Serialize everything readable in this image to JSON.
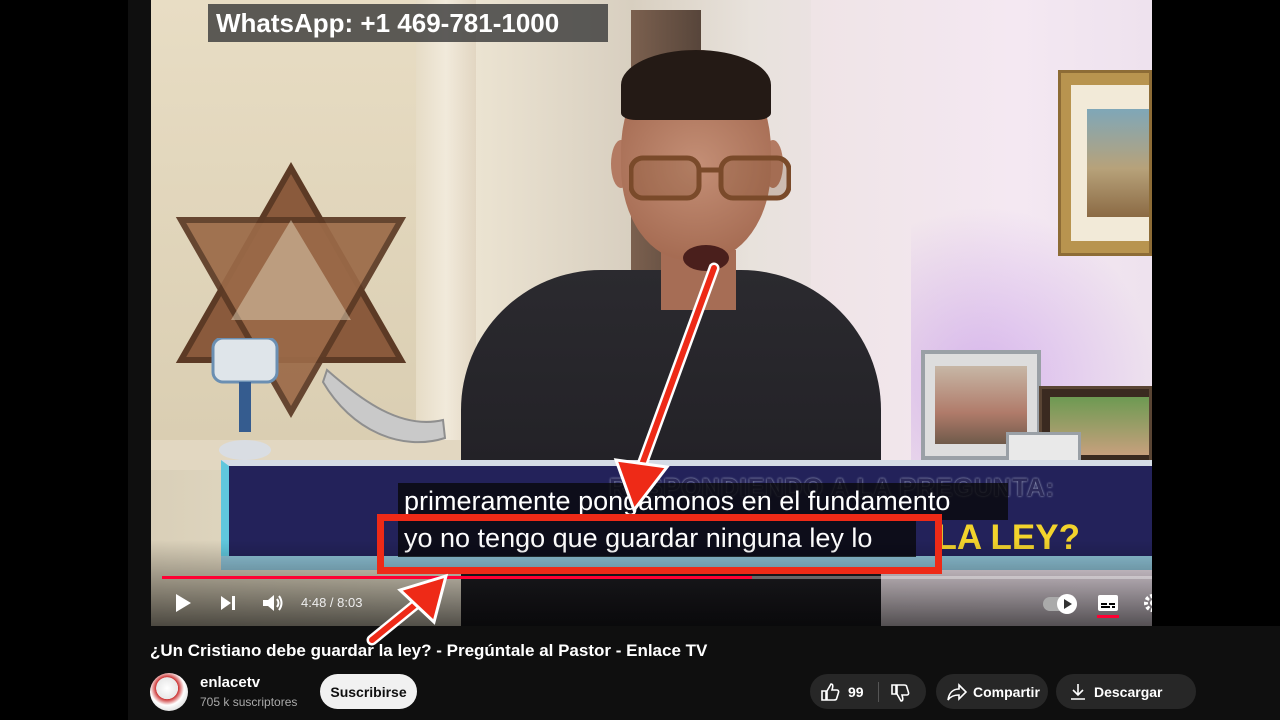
{
  "overlay": {
    "whatsapp": "WhatsApp: +1 469-781-1000",
    "banner_top": "RESPONDIENDO A LA PREGUNTA:",
    "banner_law": "LA LEY?"
  },
  "captions": [
    "primeramente pongámonos en el fundamento",
    "yo no tengo que guardar ninguna ley lo"
  ],
  "player": {
    "current_time": "4:48",
    "duration": "8:03",
    "time_display": "4:48 / 8:03",
    "progress_fraction": 0.5964,
    "play_icon": "play-icon",
    "next_icon": "next-icon",
    "volume_icon": "volume-icon",
    "autoplay_icon": "autoplay-toggle",
    "subtitles_icon": "subtitles-icon",
    "settings_icon": "settings-icon",
    "accent_color": "#ff0033"
  },
  "video": {
    "title": "¿Un Cristiano debe guardar la ley? - Pregúntale al Pastor - Enlace TV",
    "channel": "enlacetv",
    "subscribers": "705 k suscriptores",
    "subscribe_label": "Suscribirse",
    "likes": "99",
    "share_label": "Compartir",
    "download_label": "Descargar"
  },
  "annotation": {
    "highlight_color": "#ee2a17"
  }
}
